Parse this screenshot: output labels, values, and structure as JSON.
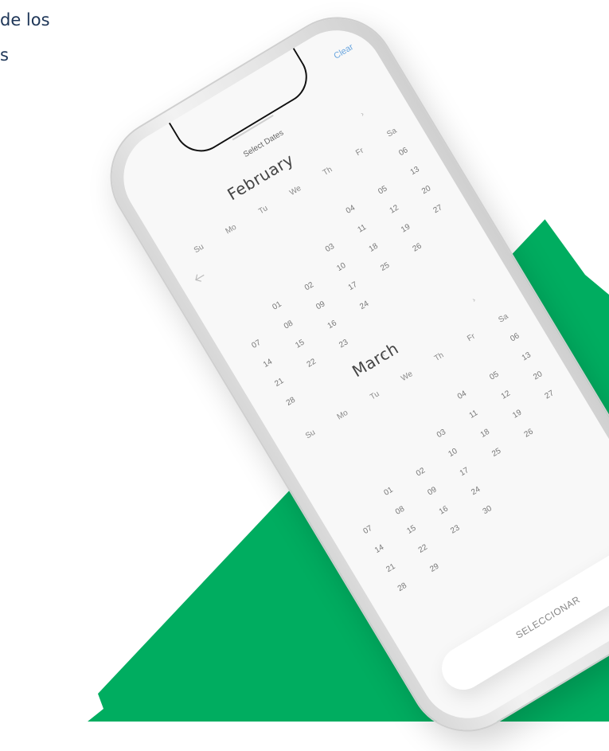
{
  "heading": {
    "line1": "de los",
    "line2": "s"
  },
  "colors": {
    "brand_green": "#00ad60",
    "accent_link": "#6aa6df"
  },
  "app": {
    "title": "Select Dates",
    "clear_label": "Clear",
    "back_icon": "back-arrow-icon",
    "select_button_label": "SELECCIONAR"
  },
  "calendar": {
    "weekday_headers": [
      "Su",
      "Mo",
      "Tu",
      "We",
      "Th",
      "Fr",
      "Sa"
    ],
    "months": [
      {
        "name": "February",
        "weeks": [
          [
            "",
            "",
            "",
            "",
            "",
            "",
            "06"
          ],
          [
            "",
            "",
            "",
            "",
            "04",
            "05",
            "13"
          ],
          [
            "",
            "",
            "",
            "03",
            "11",
            "12",
            "20"
          ],
          [
            "",
            "01",
            "02",
            "10",
            "18",
            "19",
            "27"
          ],
          [
            "07",
            "08",
            "09",
            "17",
            "25",
            "26",
            ""
          ],
          [
            "14",
            "15",
            "16",
            "24",
            "",
            "",
            ""
          ],
          [
            "21",
            "22",
            "23",
            "",
            "",
            "",
            ""
          ],
          [
            "28",
            "",
            "",
            "",
            "",
            "",
            ""
          ]
        ]
      },
      {
        "name": "March",
        "weeks": [
          [
            "",
            "",
            "",
            "",
            "",
            "",
            "06"
          ],
          [
            "",
            "",
            "",
            "",
            "04",
            "05",
            "13"
          ],
          [
            "",
            "",
            "",
            "03",
            "11",
            "12",
            "20"
          ],
          [
            "",
            "01",
            "02",
            "10",
            "18",
            "19",
            "27"
          ],
          [
            "07",
            "08",
            "09",
            "17",
            "25",
            "26",
            ""
          ],
          [
            "14",
            "15",
            "16",
            "24",
            "",
            "",
            ""
          ],
          [
            "21",
            "22",
            "23",
            "30",
            "",
            "",
            ""
          ],
          [
            "28",
            "29",
            "",
            "",
            "",
            "",
            ""
          ]
        ]
      }
    ]
  }
}
